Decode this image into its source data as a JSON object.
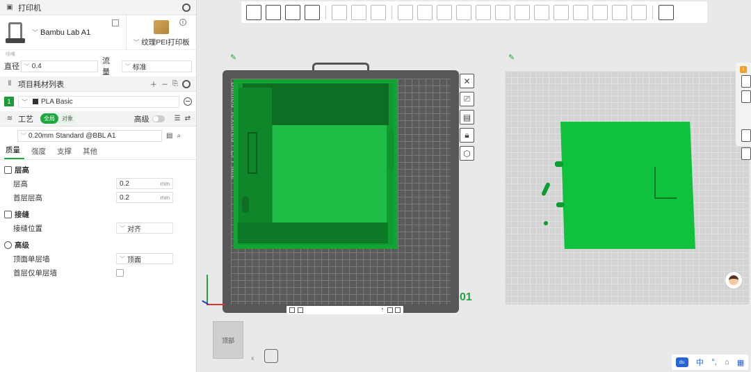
{
  "printer": {
    "section_title": "打印机",
    "name": "Bambu Lab A1",
    "plate_name": "纹理PEI打印板",
    "nozzle_tiny_label": "喷嘴",
    "diameter_label": "直径",
    "diameter_value": "0.4",
    "flow_label": "流量",
    "flow_value": "标准"
  },
  "filament": {
    "section_title": "项目耗材列表",
    "items": [
      {
        "index": "1",
        "name": "PLA Basic"
      }
    ]
  },
  "process": {
    "section_title": "工艺",
    "toggle_global": "全局",
    "toggle_object": "对象",
    "advanced_label": "高级",
    "preset": "0.20mm Standard @BBL A1",
    "tabs": [
      "质量",
      "强度",
      "支撑",
      "其他"
    ],
    "groups": {
      "layer_height": {
        "title": "层高",
        "layer_height_label": "层高",
        "layer_height_value": "0.2",
        "first_layer_label": "首层层高",
        "first_layer_value": "0.2",
        "unit": "mm"
      },
      "seam": {
        "title": "接缝",
        "position_label": "接缝位置",
        "position_value": "对齐"
      },
      "advanced": {
        "title": "高级",
        "top_single_wall_label": "顶面单层墙",
        "top_single_wall_value": "顶面",
        "first_layer_single_wall_label": "首层仅单层墙"
      }
    }
  },
  "canvas": {
    "plate_label": "Bambu Textured PEI Plate",
    "plate_number": "01",
    "view_cube_label": "顶部",
    "axis_x_label": "x"
  },
  "ime": {
    "logo": "du",
    "lang": "中"
  },
  "colors": {
    "accent": "#1ea73f",
    "model_green": "#109a30",
    "plate_dark": "#575757"
  }
}
